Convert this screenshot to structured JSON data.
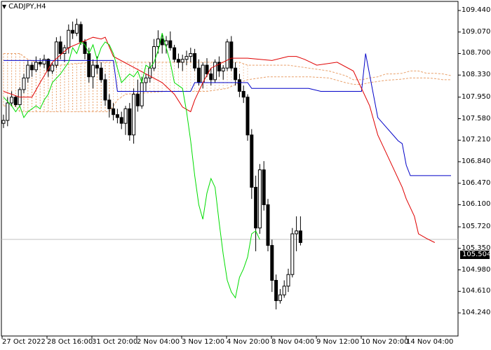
{
  "symbol": {
    "label": "CADJPY,H4"
  },
  "current_price": "105.504",
  "chart_data": {
    "type": "candlestick",
    "title": "CADJPY,H4",
    "ylim": [
      104.2,
      109.6
    ],
    "y_ticks": [
      "109.440",
      "109.070",
      "108.700",
      "108.330",
      "107.950",
      "107.580",
      "107.210",
      "106.840",
      "106.470",
      "106.100",
      "105.720",
      "105.350",
      "104.980",
      "104.610",
      "104.240"
    ],
    "x_ticks": [
      "27 Oct 2022",
      "28 Oct 16:00",
      "31 Oct 20:00",
      "2 Nov 04:00",
      "3 Nov 12:00",
      "4 Nov 20:00",
      "8 Nov 04:00",
      "9 Nov 12:00",
      "10 Nov 20:00",
      "14 Nov 04:00"
    ],
    "last_price": 105.504,
    "candles": [
      [
        107.5,
        107.65,
        107.42,
        107.55
      ],
      [
        107.55,
        107.95,
        107.45,
        107.85
      ],
      [
        107.85,
        108.05,
        107.8,
        107.95
      ],
      [
        107.95,
        107.98,
        107.78,
        107.82
      ],
      [
        107.82,
        108.12,
        107.78,
        108.08
      ],
      [
        108.08,
        108.35,
        108.02,
        108.28
      ],
      [
        108.28,
        108.58,
        108.2,
        108.5
      ],
      [
        108.5,
        108.55,
        108.3,
        108.42
      ],
      [
        108.42,
        108.65,
        108.38,
        108.55
      ],
      [
        108.55,
        108.62,
        108.48,
        108.52
      ],
      [
        108.52,
        108.68,
        108.45,
        108.6
      ],
      [
        108.6,
        108.62,
        108.3,
        108.4
      ],
      [
        108.4,
        108.55,
        108.35,
        108.5
      ],
      [
        108.5,
        108.98,
        108.45,
        108.9
      ],
      [
        108.9,
        109.0,
        108.6,
        108.7
      ],
      [
        108.7,
        108.85,
        108.55,
        108.8
      ],
      [
        108.8,
        109.2,
        108.7,
        109.1
      ],
      [
        109.1,
        109.25,
        108.95,
        109.05
      ],
      [
        109.05,
        109.3,
        109.0,
        109.2
      ],
      [
        109.2,
        109.25,
        108.85,
        108.9
      ],
      [
        108.9,
        108.95,
        108.6,
        108.7
      ],
      [
        108.7,
        108.8,
        108.2,
        108.3
      ],
      [
        108.3,
        108.6,
        108.1,
        108.5
      ],
      [
        108.5,
        108.65,
        108.35,
        108.45
      ],
      [
        108.45,
        108.55,
        108.2,
        108.25
      ],
      [
        108.25,
        108.35,
        107.8,
        107.9
      ],
      [
        107.9,
        108.0,
        107.6,
        107.75
      ],
      [
        107.75,
        107.85,
        107.55,
        107.65
      ],
      [
        107.65,
        107.75,
        107.5,
        107.6
      ],
      [
        107.6,
        107.7,
        107.4,
        107.5
      ],
      [
        107.5,
        107.8,
        107.3,
        107.75
      ],
      [
        107.75,
        107.85,
        107.2,
        107.3
      ],
      [
        107.3,
        108.1,
        107.15,
        108.0
      ],
      [
        108.0,
        108.25,
        107.7,
        107.8
      ],
      [
        107.8,
        108.3,
        107.75,
        108.2
      ],
      [
        108.2,
        108.35,
        108.05,
        108.28
      ],
      [
        108.28,
        108.55,
        108.2,
        108.45
      ],
      [
        108.45,
        108.95,
        108.4,
        108.82
      ],
      [
        108.82,
        109.1,
        108.7,
        108.95
      ],
      [
        108.95,
        109.05,
        108.7,
        108.85
      ],
      [
        108.85,
        109.0,
        108.7,
        108.92
      ],
      [
        108.92,
        109.08,
        108.75,
        108.8
      ],
      [
        108.8,
        108.85,
        108.55,
        108.6
      ],
      [
        108.6,
        108.7,
        108.45,
        108.55
      ],
      [
        108.55,
        108.68,
        108.4,
        108.6
      ],
      [
        108.6,
        108.75,
        108.5,
        108.65
      ],
      [
        108.65,
        108.8,
        108.55,
        108.7
      ],
      [
        108.7,
        108.78,
        108.4,
        108.45
      ],
      [
        108.45,
        108.6,
        108.15,
        108.2
      ],
      [
        108.2,
        108.55,
        108.1,
        108.5
      ],
      [
        108.5,
        108.62,
        108.3,
        108.35
      ],
      [
        108.35,
        108.45,
        108.15,
        108.25
      ],
      [
        108.25,
        108.6,
        108.2,
        108.55
      ],
      [
        108.55,
        108.65,
        108.3,
        108.4
      ],
      [
        108.4,
        108.5,
        108.25,
        108.45
      ],
      [
        108.45,
        108.95,
        108.4,
        108.9
      ],
      [
        108.9,
        109.0,
        108.4,
        108.45
      ],
      [
        108.45,
        108.55,
        108.15,
        108.25
      ],
      [
        108.25,
        108.35,
        107.95,
        108.05
      ],
      [
        108.05,
        108.15,
        107.85,
        107.95
      ],
      [
        107.95,
        108.0,
        107.2,
        107.3
      ],
      [
        107.3,
        107.4,
        106.2,
        106.4
      ],
      [
        106.4,
        106.6,
        105.3,
        105.7
      ],
      [
        105.7,
        106.8,
        105.6,
        106.7
      ],
      [
        106.7,
        106.85,
        106.0,
        106.1
      ],
      [
        106.1,
        106.2,
        105.3,
        105.4
      ],
      [
        105.4,
        105.5,
        104.6,
        104.8
      ],
      [
        104.8,
        104.9,
        104.3,
        104.45
      ],
      [
        104.45,
        104.65,
        104.4,
        104.55
      ],
      [
        104.55,
        104.8,
        104.5,
        104.7
      ],
      [
        104.7,
        105.0,
        104.6,
        104.9
      ],
      [
        104.9,
        105.7,
        104.85,
        105.6
      ],
      [
        105.6,
        105.9,
        105.3,
        105.65
      ],
      [
        105.65,
        105.9,
        105.4,
        105.45
      ]
    ],
    "kijun_sen": [
      [
        0,
        108.58
      ],
      [
        27,
        108.58
      ],
      [
        28,
        108.05
      ],
      [
        35,
        108.05
      ],
      [
        36,
        108.05
      ],
      [
        46,
        108.05
      ],
      [
        47,
        108.2
      ],
      [
        60,
        108.2
      ],
      [
        61,
        108.1
      ],
      [
        75,
        108.1
      ],
      [
        78,
        108.05
      ],
      [
        82,
        108.05
      ],
      [
        83,
        108.05
      ],
      [
        88,
        108.05
      ],
      [
        89,
        108.7
      ],
      [
        92,
        107.6
      ],
      [
        97,
        107.2
      ],
      [
        98,
        107.15
      ],
      [
        99,
        106.78
      ],
      [
        100,
        106.6
      ],
      [
        104,
        106.6
      ],
      [
        110,
        106.6
      ]
    ],
    "tenkan_sen": [
      [
        0,
        108.05
      ],
      [
        4,
        107.95
      ],
      [
        7,
        107.95
      ],
      [
        9,
        108.2
      ],
      [
        12,
        108.55
      ],
      [
        16,
        108.8
      ],
      [
        22,
        108.98
      ],
      [
        24,
        108.95
      ],
      [
        25,
        108.98
      ],
      [
        27,
        108.65
      ],
      [
        31,
        108.5
      ],
      [
        35,
        108.35
      ],
      [
        39,
        108.2
      ],
      [
        42,
        108.0
      ],
      [
        44,
        107.78
      ],
      [
        46,
        107.7
      ],
      [
        47,
        107.9
      ],
      [
        49,
        108.2
      ],
      [
        51,
        108.45
      ],
      [
        56,
        108.62
      ],
      [
        60,
        108.62
      ],
      [
        66,
        108.58
      ],
      [
        70,
        108.65
      ],
      [
        72,
        108.65
      ],
      [
        74,
        108.6
      ],
      [
        77,
        108.5
      ],
      [
        82,
        108.55
      ],
      [
        86,
        108.4
      ],
      [
        88,
        108.1
      ],
      [
        90,
        107.8
      ],
      [
        92,
        107.3
      ],
      [
        94,
        107.0
      ],
      [
        96,
        106.7
      ],
      [
        98,
        106.4
      ],
      [
        99,
        106.2
      ],
      [
        101,
        105.9
      ],
      [
        102,
        105.6
      ],
      [
        104,
        105.52
      ],
      [
        106,
        105.45
      ]
    ],
    "chikou_span": [
      [
        0,
        107.95
      ],
      [
        2,
        107.8
      ],
      [
        3,
        107.7
      ],
      [
        4,
        107.8
      ],
      [
        5,
        107.6
      ],
      [
        6,
        107.7
      ],
      [
        8,
        107.8
      ],
      [
        9,
        107.75
      ],
      [
        10,
        107.9
      ],
      [
        11,
        108.0
      ],
      [
        12,
        108.2
      ],
      [
        14,
        108.35
      ],
      [
        16,
        108.55
      ],
      [
        17,
        108.8
      ],
      [
        18,
        108.7
      ],
      [
        19,
        108.9
      ],
      [
        20,
        108.85
      ],
      [
        21,
        108.7
      ],
      [
        22,
        108.85
      ],
      [
        23,
        108.6
      ],
      [
        24,
        108.8
      ],
      [
        25,
        108.9
      ],
      [
        26,
        108.85
      ],
      [
        27,
        108.7
      ],
      [
        28,
        108.45
      ],
      [
        29,
        108.2
      ],
      [
        31,
        108.35
      ],
      [
        32,
        108.3
      ],
      [
        33,
        108.4
      ],
      [
        34,
        108.2
      ],
      [
        35,
        108.5
      ],
      [
        36,
        108.45
      ],
      [
        37,
        108.55
      ],
      [
        38,
        108.75
      ],
      [
        39,
        109.05
      ],
      [
        40,
        108.8
      ],
      [
        41,
        108.55
      ],
      [
        42,
        108.2
      ],
      [
        44,
        108.1
      ],
      [
        45,
        107.7
      ],
      [
        46,
        107.2
      ],
      [
        47,
        106.6
      ],
      [
        48,
        106.1
      ],
      [
        49,
        105.85
      ],
      [
        50,
        106.3
      ],
      [
        51,
        106.55
      ],
      [
        52,
        106.4
      ],
      [
        53,
        105.8
      ],
      [
        54,
        105.25
      ],
      [
        55,
        104.8
      ],
      [
        56,
        104.6
      ],
      [
        57,
        104.5
      ],
      [
        58,
        104.85
      ],
      [
        59,
        105.0
      ],
      [
        60,
        105.2
      ],
      [
        61,
        105.6
      ],
      [
        62,
        105.65
      ],
      [
        63,
        105.5
      ]
    ],
    "cloud_upper": [
      [
        0,
        108.7
      ],
      [
        4,
        108.7
      ],
      [
        6,
        108.6
      ],
      [
        8,
        108.55
      ],
      [
        12,
        108.48
      ],
      [
        16,
        108.52
      ],
      [
        22,
        108.55
      ],
      [
        26,
        108.55
      ],
      [
        30,
        108.55
      ],
      [
        34,
        108.55
      ],
      [
        40,
        108.55
      ],
      [
        50,
        108.55
      ],
      [
        58,
        108.55
      ],
      [
        60,
        108.5
      ],
      [
        70,
        108.5
      ],
      [
        80,
        108.4
      ],
      [
        84,
        108.32
      ],
      [
        86,
        108.25
      ],
      [
        88,
        108.25
      ],
      [
        90,
        108.28
      ],
      [
        92,
        108.3
      ],
      [
        94,
        108.35
      ],
      [
        96,
        108.35
      ],
      [
        98,
        108.36
      ],
      [
        100,
        108.4
      ],
      [
        102,
        108.4
      ],
      [
        104,
        108.36
      ],
      [
        106,
        108.36
      ],
      [
        108,
        108.35
      ],
      [
        110,
        108.32
      ]
    ],
    "cloud_lower": [
      [
        0,
        107.8
      ],
      [
        3,
        107.8
      ],
      [
        4,
        107.7
      ],
      [
        8,
        107.7
      ],
      [
        12,
        107.7
      ],
      [
        16,
        107.7
      ],
      [
        22,
        107.7
      ],
      [
        26,
        107.7
      ],
      [
        28,
        107.9
      ],
      [
        30,
        108.0
      ],
      [
        34,
        108.02
      ],
      [
        40,
        108.05
      ],
      [
        45,
        108.05
      ],
      [
        50,
        108.05
      ],
      [
        55,
        108.1
      ],
      [
        58,
        108.2
      ],
      [
        60,
        108.25
      ],
      [
        65,
        108.3
      ],
      [
        70,
        108.3
      ],
      [
        75,
        108.3
      ],
      [
        80,
        108.28
      ],
      [
        84,
        108.2
      ],
      [
        86,
        108.17
      ],
      [
        88,
        108.17
      ],
      [
        90,
        108.2
      ],
      [
        92,
        108.22
      ],
      [
        94,
        108.24
      ],
      [
        96,
        108.25
      ],
      [
        98,
        108.26
      ],
      [
        100,
        108.28
      ],
      [
        102,
        108.28
      ],
      [
        104,
        108.28
      ],
      [
        106,
        108.27
      ],
      [
        108,
        108.25
      ],
      [
        110,
        108.25
      ]
    ]
  }
}
